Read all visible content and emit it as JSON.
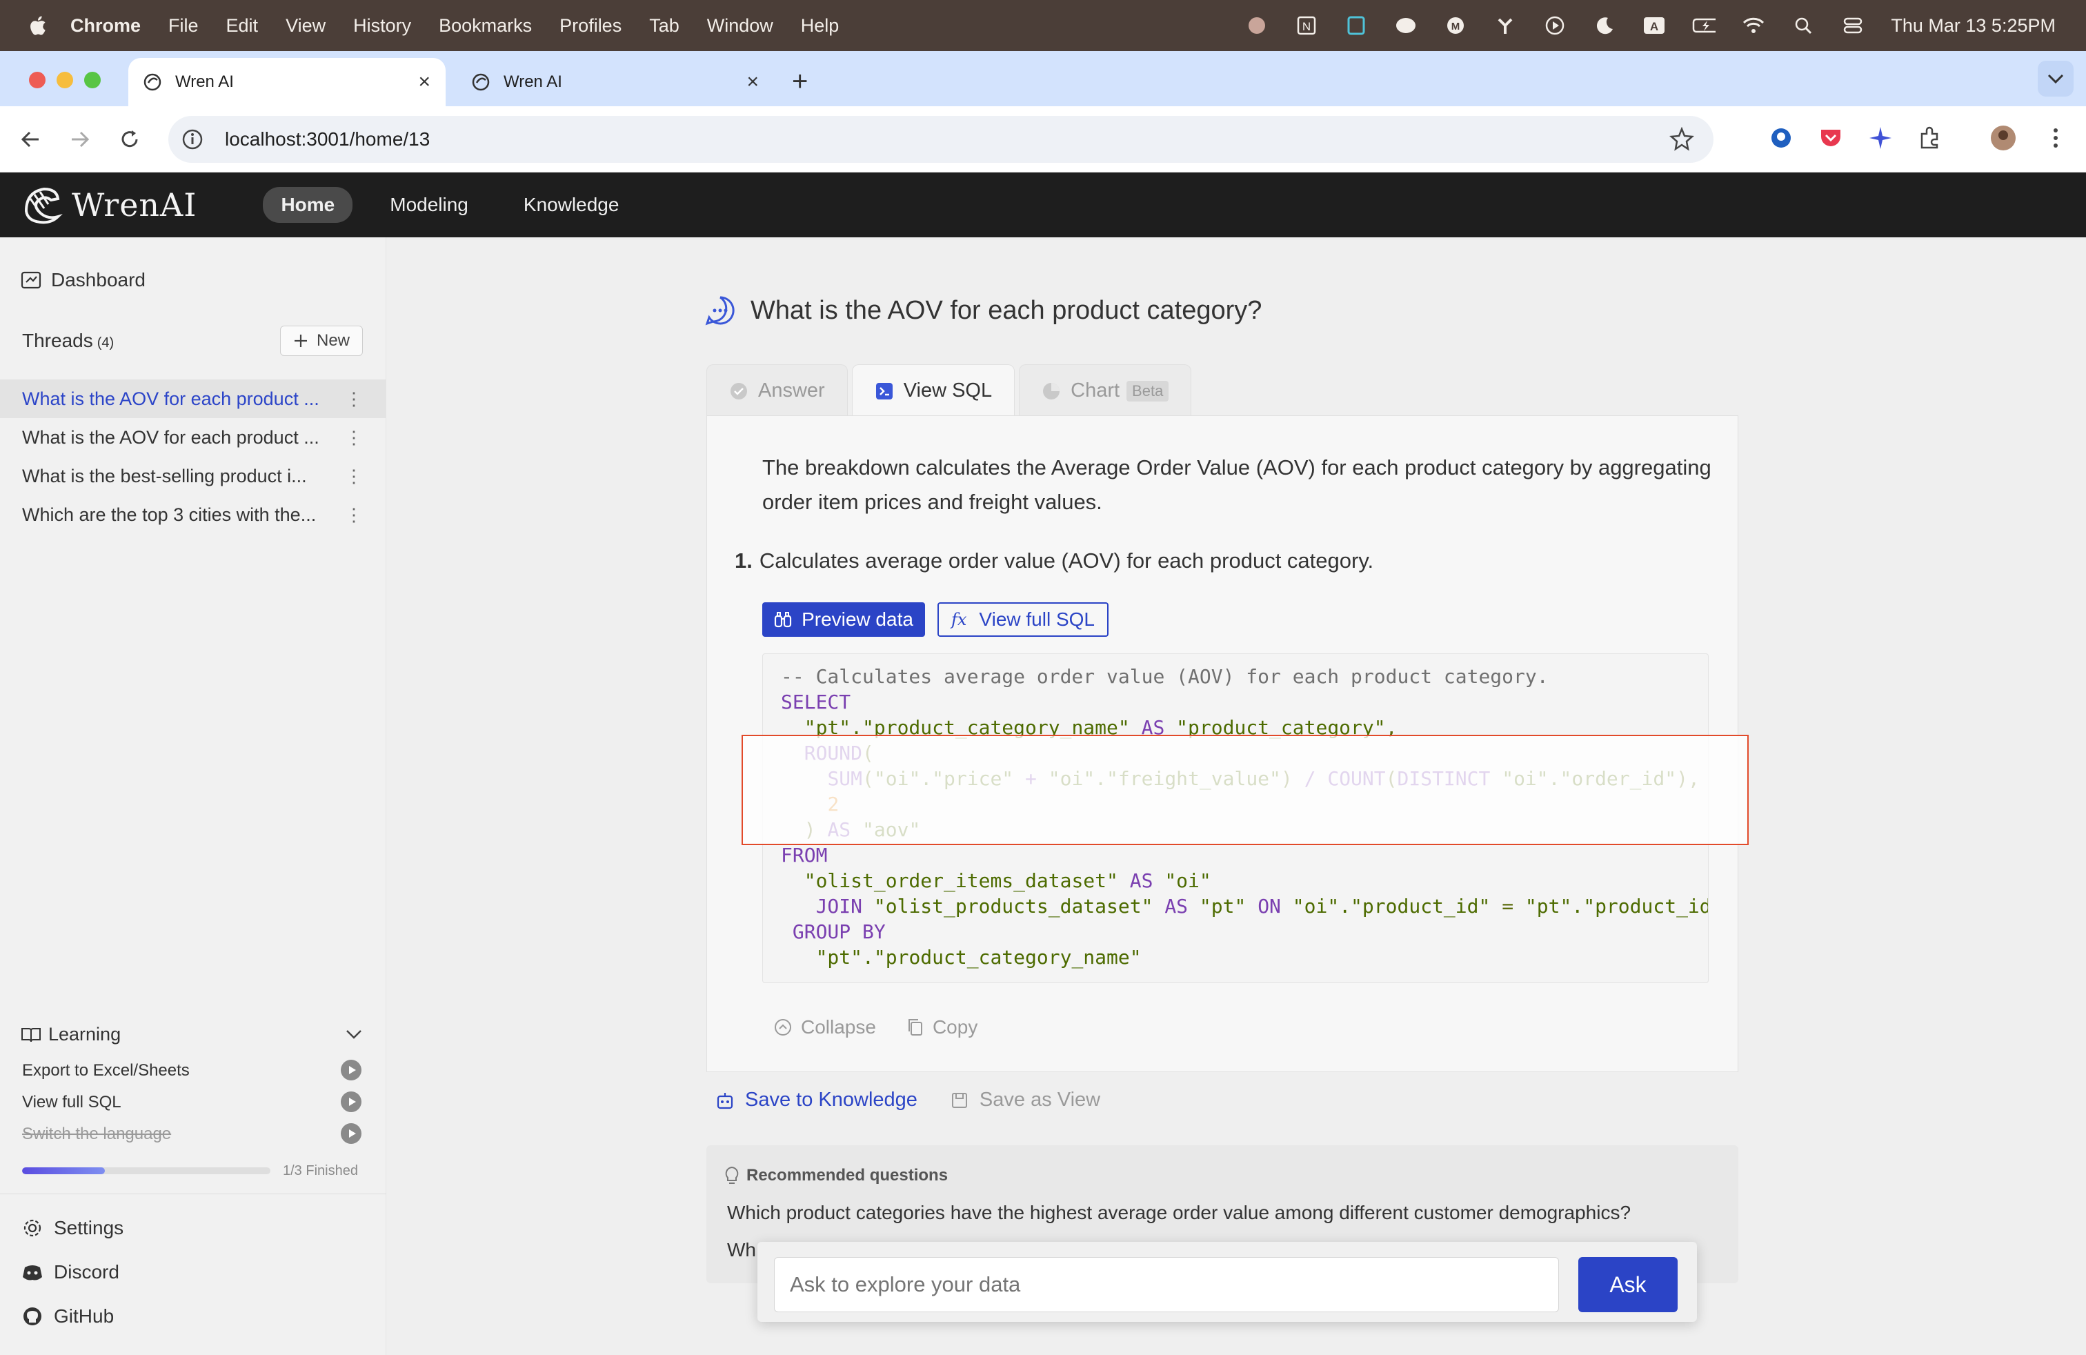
{
  "menubar": {
    "app": "Chrome",
    "items": [
      "File",
      "Edit",
      "View",
      "History",
      "Bookmarks",
      "Profiles",
      "Tab",
      "Window",
      "Help"
    ],
    "datetime": "Thu Mar 13  5:25PM"
  },
  "browser": {
    "tabs": [
      {
        "title": "Wren AI",
        "active": true
      },
      {
        "title": "Wren AI",
        "active": false
      }
    ],
    "url": "localhost:3001/home/13"
  },
  "header": {
    "logo_text": "WrenAI",
    "nav": [
      "Home",
      "Modeling",
      "Knowledge"
    ],
    "active_nav": "Home"
  },
  "sidebar": {
    "dashboard_label": "Dashboard",
    "threads_label": "Threads",
    "threads_count": "(4)",
    "new_label": "New",
    "threads": [
      "What is the AOV for each product ...",
      "What is the AOV for each product ...",
      "What is the best-selling product i...",
      "Which are the top 3 cities with the..."
    ],
    "learning": {
      "title": "Learning",
      "items": [
        {
          "label": "Export to Excel/Sheets",
          "done": false
        },
        {
          "label": "View full SQL",
          "done": false
        },
        {
          "label": "Switch the language",
          "done": true
        }
      ],
      "progress_fraction": 0.333,
      "progress_text": "1/3 Finished"
    },
    "links": [
      "Settings",
      "Discord",
      "GitHub"
    ]
  },
  "main": {
    "question": "What is the AOV for each product category?",
    "tabs": [
      "Answer",
      "View SQL",
      "Chart"
    ],
    "beta_label": "Beta",
    "summary": "The breakdown calculates the Average Order Value (AOV) for each product category by aggregating order item prices and freight values.",
    "step_number": "1.",
    "step_text": "Calculates average order value (AOV) for each product category.",
    "preview_label": "Preview data",
    "view_full_sql_label": "View full SQL",
    "collapse_label": "Collapse",
    "copy_label": "Copy",
    "save_knowledge_label": "Save to Knowledge",
    "save_view_label": "Save as View",
    "recommended_title": "Recommended questions",
    "recommended": [
      "Which product categories have the highest average order value among different customer demographics?",
      "Wh"
    ],
    "ask_placeholder": "Ask to explore your data",
    "ask_label": "Ask"
  }
}
